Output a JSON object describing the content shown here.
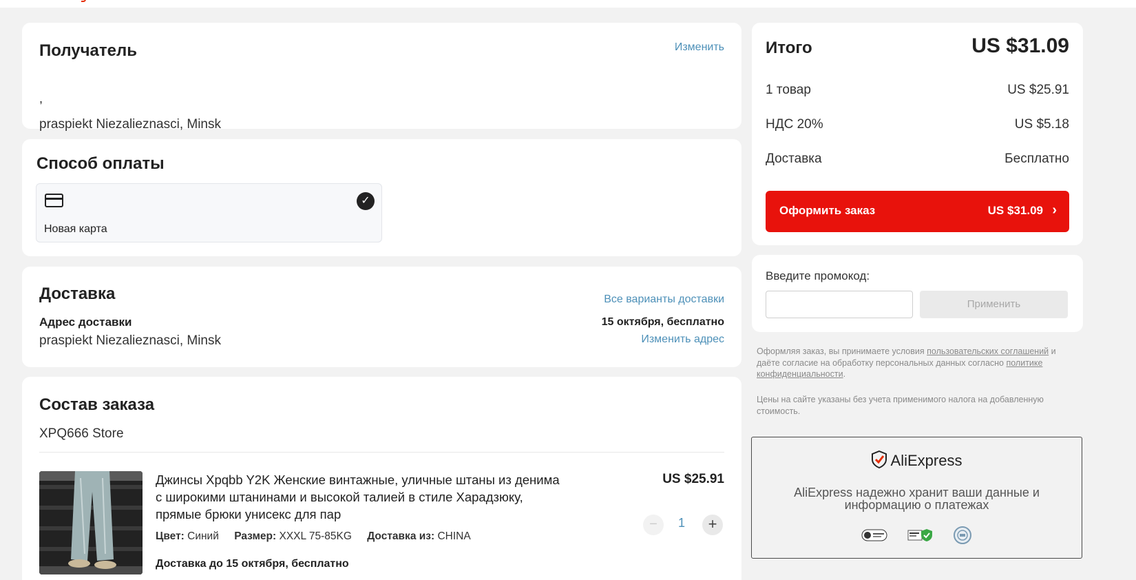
{
  "recipient": {
    "title": "Получатель",
    "change_link": "Изменить",
    "name": ",",
    "address": "praspiekt Niezalieznasci, Minsk"
  },
  "payment": {
    "title": "Способ оплаты",
    "method_label": "Новая карта",
    "icon": "credit-card-icon"
  },
  "delivery": {
    "title": "Доставка",
    "all_options_link": "Все варианты доставки",
    "address_label": "Адрес доставки",
    "address": "praspiekt Niezalieznasci, Minsk",
    "date": "15 октября, бесплатно",
    "change_address_link": "Изменить адрес"
  },
  "order": {
    "title": "Состав заказа",
    "store": "XPQ666 Store",
    "item": {
      "title": "Джинсы Xpqbb Y2K Женские винтажные, уличные штаны из денима с широкими штанинами и высокой талией в стиле Харадзюку, прямые брюки унисекс для пар",
      "color_label": "Цвет:",
      "color": "Синий",
      "size_label": "Размер:",
      "size": "XXXL 75-85KG",
      "ship_from_label": "Доставка из:",
      "ship_from": "CHINA",
      "shipping": "Доставка до 15 октября, бесплатно",
      "price": "US $25.91",
      "quantity": "1"
    }
  },
  "summary": {
    "total_label": "Итого",
    "total": "US $31.09",
    "items_label": "1 товар",
    "items_value": "US $25.91",
    "vat_label": "НДС 20%",
    "vat_value": "US $5.18",
    "shipping_label": "Доставка",
    "shipping_value": "Бесплатно",
    "checkout_label": "Оформить заказ",
    "checkout_value": "US $31.09",
    "accent_color": "#e8120c"
  },
  "promo": {
    "label": "Введите промокод:",
    "value": "",
    "apply_label": "Применить"
  },
  "legal": {
    "terms_prefix": "Оформляя заказ, вы принимаете условия",
    "terms_link": "пользовательских соглашений",
    "terms_middle": "и даёте согласие на обработку персональных данных согласно",
    "privacy_link": "политике конфиденциальности",
    "terms_suffix": ".",
    "vat_note": "Цены на сайте указаны без учета применимого налога на добавленную стоимость."
  },
  "trust": {
    "brand": "AliExpress",
    "message": "AliExpress надежно хранит ваши данные и информацию о платежах"
  }
}
